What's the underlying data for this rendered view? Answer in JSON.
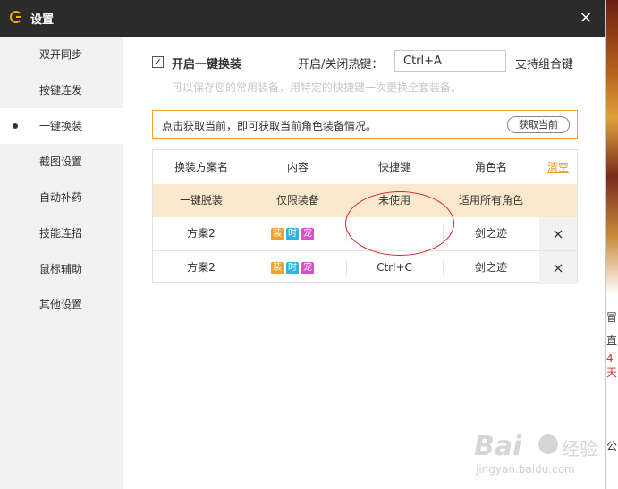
{
  "window": {
    "title": "设置",
    "close_glyph": "×"
  },
  "sidebar": {
    "items": [
      {
        "label": "双开同步"
      },
      {
        "label": "按键连发"
      },
      {
        "label": "一键换装",
        "active": true
      },
      {
        "label": "截图设置"
      },
      {
        "label": "自动补药"
      },
      {
        "label": "技能连招"
      },
      {
        "label": "鼠标辅助"
      },
      {
        "label": "其他设置"
      }
    ]
  },
  "main": {
    "enable_checkbox": {
      "label": "开启一键换装",
      "checked": true,
      "check_glyph": "✓"
    },
    "hotkey": {
      "label": "开启/关闭热键：",
      "value": "Ctrl+A",
      "note": "支持组合键"
    },
    "hint": "可以保存您的常用装备，用特定的快捷键一次更换全套装备。",
    "notice": {
      "text": "点击获取当前，即可获取当前角色装备情况。",
      "button": "获取当前"
    },
    "table": {
      "headers": [
        "换装方案名",
        "内容",
        "快捷键",
        "角色名"
      ],
      "clear_label": "清空",
      "fixed_row": [
        "一键脱装",
        "仅限装备",
        "未使用",
        "适用所有角色"
      ],
      "rows": [
        {
          "name": "方案2",
          "tags": [
            "装",
            "时",
            "宠"
          ],
          "hotkey": "",
          "role": "剑之迹",
          "delete": "×"
        },
        {
          "name": "方案2",
          "tags": [
            "装",
            "时",
            "宠"
          ],
          "hotkey": "Ctrl+C",
          "role": "剑之迹",
          "delete": "×"
        }
      ],
      "tag_colors": [
        "#f0a12a",
        "#2fb4e0",
        "#d84fc8"
      ]
    }
  },
  "background": {
    "fragments": [
      "冒",
      "直",
      "4天",
      "公"
    ]
  },
  "watermark": {
    "brand": "Bai",
    "brand_cn": "经验",
    "url": "jingyan.baidu.com"
  },
  "colors": {
    "titlebar": "#2b2b2b",
    "accent": "#f0a12a",
    "annotation": "#d9222a"
  }
}
